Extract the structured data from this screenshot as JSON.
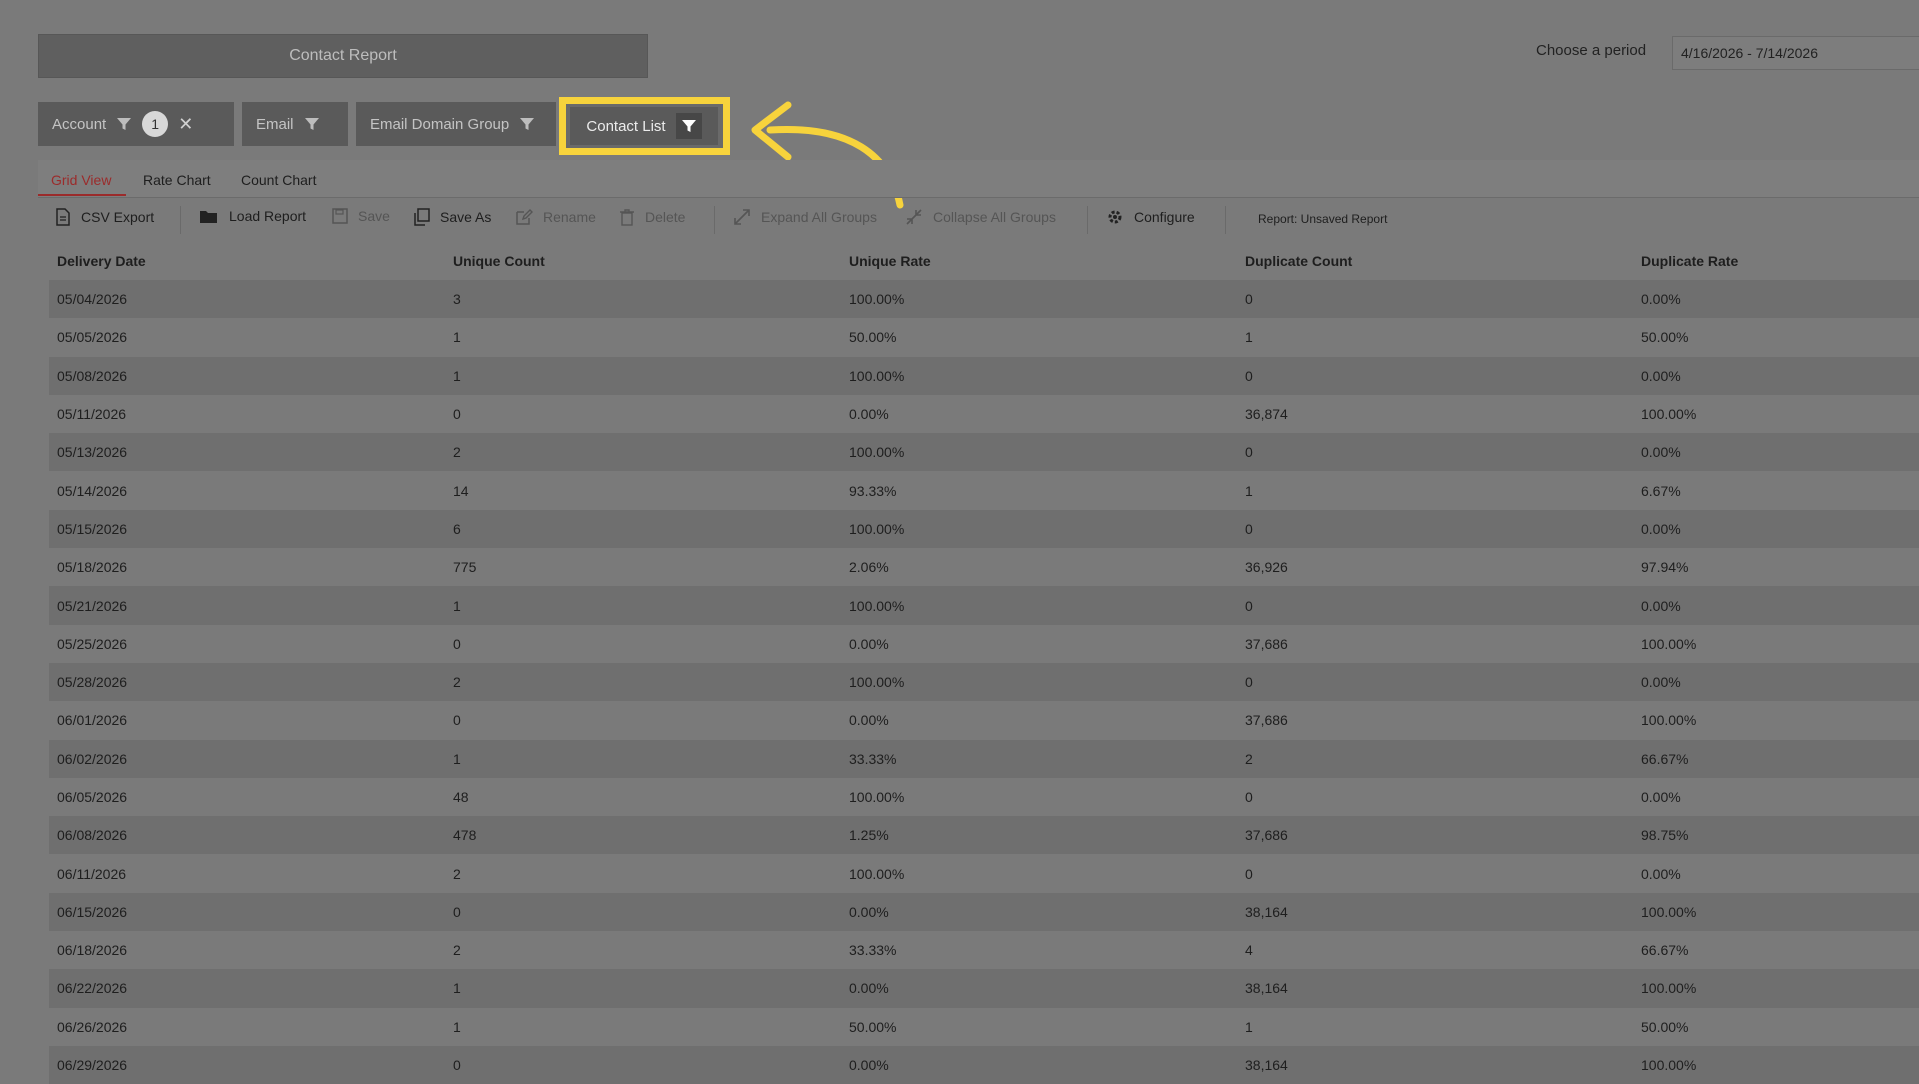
{
  "header": {
    "title": "Contact Report"
  },
  "period": {
    "label": "Choose a period",
    "value": "4/16/2026 - 7/14/2026"
  },
  "filters": {
    "account": {
      "label": "Account",
      "count": "1",
      "clear": "✕"
    },
    "email": {
      "label": "Email"
    },
    "email_domain_group": {
      "label": "Email Domain Group"
    },
    "contact_list": {
      "label": "Contact List"
    }
  },
  "tabs": [
    {
      "label": "Grid View",
      "active": true
    },
    {
      "label": "Rate Chart",
      "active": false
    },
    {
      "label": "Count Chart",
      "active": false
    }
  ],
  "toolbar": {
    "csv_export": "CSV Export",
    "load_report": "Load Report",
    "save": "Save",
    "save_as": "Save As",
    "rename": "Rename",
    "delete": "Delete",
    "expand_all": "Expand All Groups",
    "collapse_all": "Collapse All Groups",
    "configure": "Configure",
    "report_label": "Report: Unsaved Report"
  },
  "table": {
    "columns": [
      "Delivery Date",
      "Unique Count",
      "Unique Rate",
      "Duplicate Count",
      "Duplicate Rate"
    ],
    "rows": [
      [
        "05/04/2026",
        "3",
        "100.00%",
        "0",
        "0.00%"
      ],
      [
        "05/05/2026",
        "1",
        "50.00%",
        "1",
        "50.00%"
      ],
      [
        "05/08/2026",
        "1",
        "100.00%",
        "0",
        "0.00%"
      ],
      [
        "05/11/2026",
        "0",
        "0.00%",
        "36,874",
        "100.00%"
      ],
      [
        "05/13/2026",
        "2",
        "100.00%",
        "0",
        "0.00%"
      ],
      [
        "05/14/2026",
        "14",
        "93.33%",
        "1",
        "6.67%"
      ],
      [
        "05/15/2026",
        "6",
        "100.00%",
        "0",
        "0.00%"
      ],
      [
        "05/18/2026",
        "775",
        "2.06%",
        "36,926",
        "97.94%"
      ],
      [
        "05/21/2026",
        "1",
        "100.00%",
        "0",
        "0.00%"
      ],
      [
        "05/25/2026",
        "0",
        "0.00%",
        "37,686",
        "100.00%"
      ],
      [
        "05/28/2026",
        "2",
        "100.00%",
        "0",
        "0.00%"
      ],
      [
        "06/01/2026",
        "0",
        "0.00%",
        "37,686",
        "100.00%"
      ],
      [
        "06/02/2026",
        "1",
        "33.33%",
        "2",
        "66.67%"
      ],
      [
        "06/05/2026",
        "48",
        "100.00%",
        "0",
        "0.00%"
      ],
      [
        "06/08/2026",
        "478",
        "1.25%",
        "37,686",
        "98.75%"
      ],
      [
        "06/11/2026",
        "2",
        "100.00%",
        "0",
        "0.00%"
      ],
      [
        "06/15/2026",
        "0",
        "0.00%",
        "38,164",
        "100.00%"
      ],
      [
        "06/18/2026",
        "2",
        "33.33%",
        "4",
        "66.67%"
      ],
      [
        "06/22/2026",
        "1",
        "0.00%",
        "38,164",
        "100.00%"
      ],
      [
        "06/26/2026",
        "1",
        "50.00%",
        "1",
        "50.00%"
      ],
      [
        "06/29/2026",
        "0",
        "0.00%",
        "38,164",
        "100.00%"
      ]
    ]
  },
  "colors": {
    "highlight": "#f7d33c",
    "active_tab": "#9b2b2b"
  },
  "icons": [
    "filter-icon",
    "close-icon",
    "file-icon",
    "folder-icon",
    "save-icon",
    "copy-icon",
    "edit-icon",
    "trash-icon",
    "expand-icon",
    "collapse-icon",
    "gear-icon",
    "arrow-annotation-icon"
  ]
}
